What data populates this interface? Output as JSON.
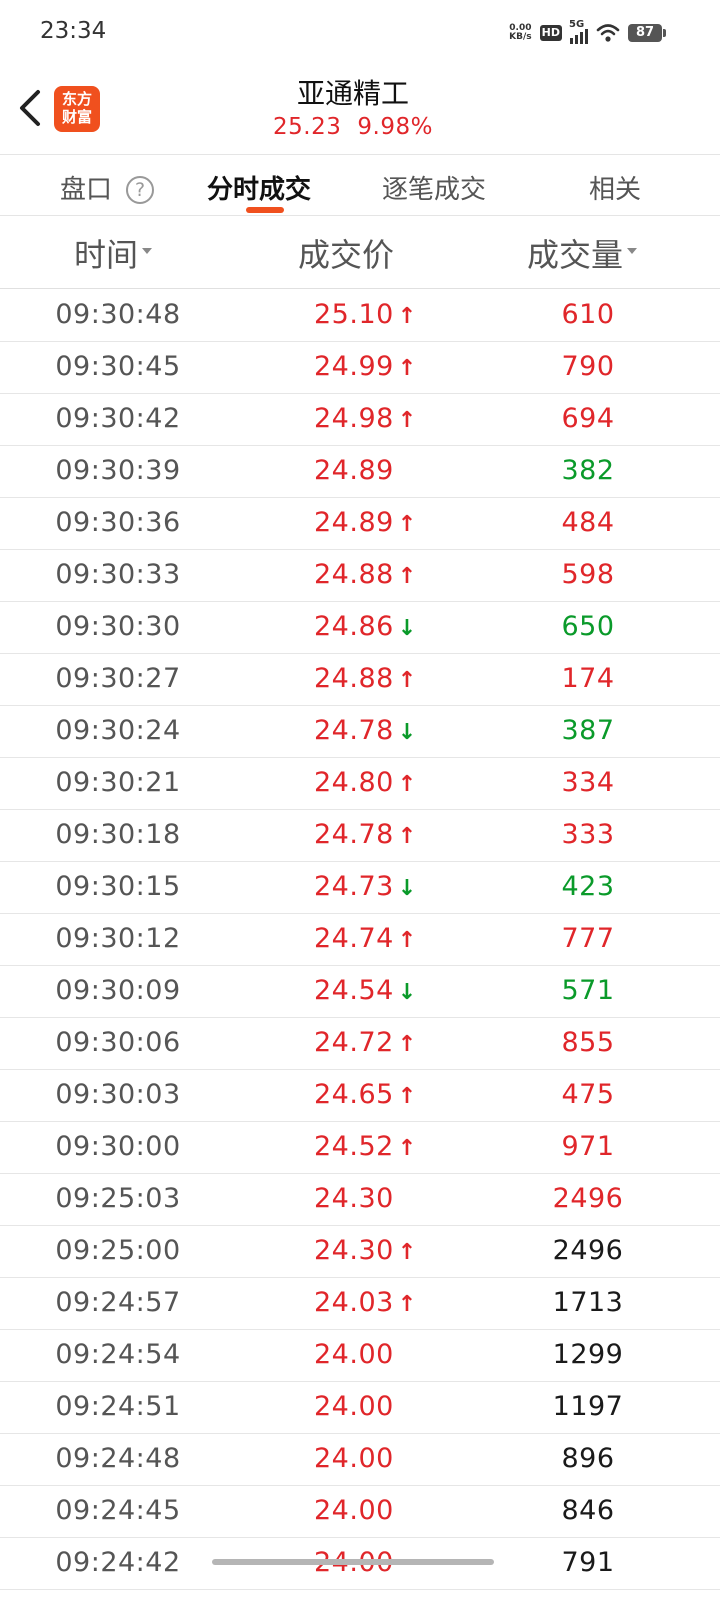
{
  "status_bar": {
    "time": "23:34",
    "net_speed_value": "0.00",
    "net_speed_unit": "KB/s",
    "hd": "HD",
    "network": "5G",
    "battery": "87"
  },
  "header": {
    "logo_line1": "东方",
    "logo_line2": "财富",
    "stock_name": "亚通精工",
    "price": "25.23",
    "change_pct": "9.98%"
  },
  "tabs": [
    {
      "label": "盘口",
      "active": false
    },
    {
      "label": "分时成交",
      "active": true
    },
    {
      "label": "逐笔成交",
      "active": false
    },
    {
      "label": "相关",
      "active": false
    }
  ],
  "tab_help": "?",
  "columns": {
    "time": "时间",
    "price": "成交价",
    "volume": "成交量"
  },
  "colors": {
    "up": "#e0262a",
    "down": "#0a9a2a",
    "accent": "#f0501e"
  },
  "trades": [
    {
      "time": "09:30:48",
      "price": "25.10",
      "dir": "up",
      "volume": "610",
      "vol_color": "up"
    },
    {
      "time": "09:30:45",
      "price": "24.99",
      "dir": "up",
      "volume": "790",
      "vol_color": "up"
    },
    {
      "time": "09:30:42",
      "price": "24.98",
      "dir": "up",
      "volume": "694",
      "vol_color": "up"
    },
    {
      "time": "09:30:39",
      "price": "24.89",
      "dir": "",
      "volume": "382",
      "vol_color": "down"
    },
    {
      "time": "09:30:36",
      "price": "24.89",
      "dir": "up",
      "volume": "484",
      "vol_color": "up"
    },
    {
      "time": "09:30:33",
      "price": "24.88",
      "dir": "up",
      "volume": "598",
      "vol_color": "up"
    },
    {
      "time": "09:30:30",
      "price": "24.86",
      "dir": "down",
      "volume": "650",
      "vol_color": "down"
    },
    {
      "time": "09:30:27",
      "price": "24.88",
      "dir": "up",
      "volume": "174",
      "vol_color": "up"
    },
    {
      "time": "09:30:24",
      "price": "24.78",
      "dir": "down",
      "volume": "387",
      "vol_color": "down"
    },
    {
      "time": "09:30:21",
      "price": "24.80",
      "dir": "up",
      "volume": "334",
      "vol_color": "up"
    },
    {
      "time": "09:30:18",
      "price": "24.78",
      "dir": "up",
      "volume": "333",
      "vol_color": "up"
    },
    {
      "time": "09:30:15",
      "price": "24.73",
      "dir": "down",
      "volume": "423",
      "vol_color": "down"
    },
    {
      "time": "09:30:12",
      "price": "24.74",
      "dir": "up",
      "volume": "777",
      "vol_color": "up"
    },
    {
      "time": "09:30:09",
      "price": "24.54",
      "dir": "down",
      "volume": "571",
      "vol_color": "down"
    },
    {
      "time": "09:30:06",
      "price": "24.72",
      "dir": "up",
      "volume": "855",
      "vol_color": "up"
    },
    {
      "time": "09:30:03",
      "price": "24.65",
      "dir": "up",
      "volume": "475",
      "vol_color": "up"
    },
    {
      "time": "09:30:00",
      "price": "24.52",
      "dir": "up",
      "volume": "971",
      "vol_color": "up"
    },
    {
      "time": "09:25:03",
      "price": "24.30",
      "dir": "",
      "volume": "2496",
      "vol_color": "up"
    },
    {
      "time": "09:25:00",
      "price": "24.30",
      "dir": "up",
      "volume": "2496",
      "vol_color": "neutral"
    },
    {
      "time": "09:24:57",
      "price": "24.03",
      "dir": "up",
      "volume": "1713",
      "vol_color": "neutral"
    },
    {
      "time": "09:24:54",
      "price": "24.00",
      "dir": "",
      "volume": "1299",
      "vol_color": "neutral"
    },
    {
      "time": "09:24:51",
      "price": "24.00",
      "dir": "",
      "volume": "1197",
      "vol_color": "neutral"
    },
    {
      "time": "09:24:48",
      "price": "24.00",
      "dir": "",
      "volume": "896",
      "vol_color": "neutral"
    },
    {
      "time": "09:24:45",
      "price": "24.00",
      "dir": "",
      "volume": "846",
      "vol_color": "neutral"
    },
    {
      "time": "09:24:42",
      "price": "24.00",
      "dir": "",
      "volume": "791",
      "vol_color": "neutral"
    }
  ]
}
